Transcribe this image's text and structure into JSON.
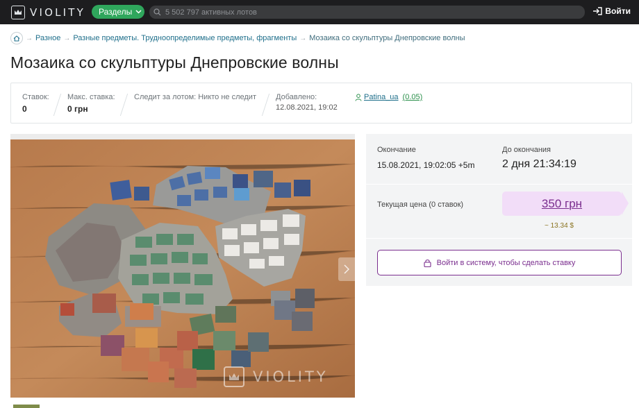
{
  "header": {
    "logo_text": "VIOLITY",
    "sections_label": "Разделы",
    "search_placeholder": "5 502 797 активных лотов",
    "login_label": "Войти"
  },
  "breadcrumb": {
    "items": [
      "Разное",
      "Разные предметы. Трудноопределимые предметы, фрагменты"
    ],
    "current": "Мозаика со скульптуры Днепровские волны"
  },
  "lot": {
    "title": "Мозаика со скульптуры Днепровские волны"
  },
  "info": {
    "bids_label": "Ставок:",
    "bids_value": "0",
    "max_bid_label": "Макс. ставка:",
    "max_bid_value": "0 грн",
    "watching_text": "Следит за лотом: Никто не следит",
    "added_label": "Добавлено:",
    "added_value": "12.08.2021, 19:02",
    "seller_name": "Patina_ua",
    "seller_rating": "(0.05)"
  },
  "gallery": {
    "watermark_text": "VIOLITY"
  },
  "auction": {
    "end_label": "Окончание",
    "end_value": "15.08.2021, 19:02:05 +5m",
    "remaining_label": "До окончания",
    "remaining_value": "2 дня 21:34:19",
    "current_price_label": "Текущая цена (0 ставок)",
    "price": "350 грн",
    "usd_price": "~ 13.34 $",
    "login_to_bid": "Войти в систему, чтобы сделать ставку"
  },
  "colors": {
    "topbar": "#1d1d1f",
    "accent_green": "#2fa65c",
    "accent_purple": "#7a2d8e",
    "price_bg": "#f2ddf8",
    "link": "#1f6f8b"
  }
}
